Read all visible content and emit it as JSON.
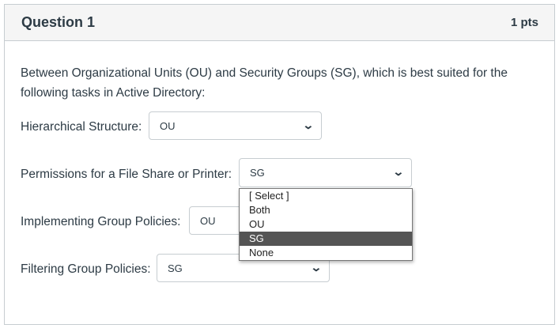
{
  "question": {
    "title": "Question 1",
    "points": "1 pts",
    "text": "Between Organizational Units (OU) and Security Groups (SG), which is best suited for the following tasks in Active Directory:"
  },
  "items": [
    {
      "label": "Hierarchical Structure:",
      "value": "OU"
    },
    {
      "label": "Permissions for a File Share or Printer:",
      "value": "SG"
    },
    {
      "label": "Implementing Group Policies:",
      "value": "OU"
    },
    {
      "label": "Filtering Group Policies:",
      "value": "SG"
    }
  ],
  "dropdown": {
    "options": [
      "[ Select ]",
      "Both",
      "OU",
      "SG",
      "None"
    ],
    "highlighted": "SG"
  }
}
